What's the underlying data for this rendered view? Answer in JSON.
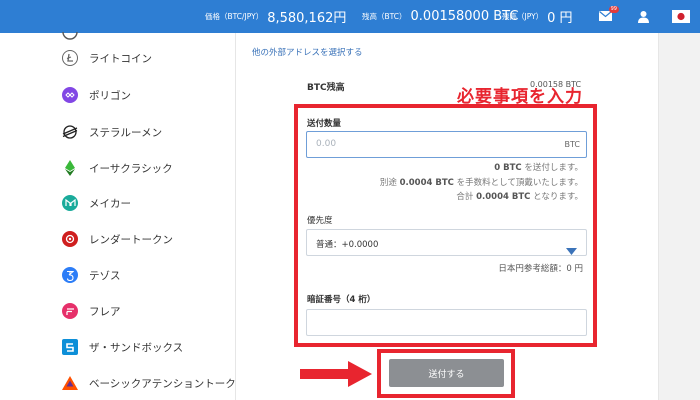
{
  "topbar": {
    "price_label": "価格（BTC/JPY）",
    "price_value": "8,580,162円",
    "btc_balance_label": "残高（BTC）",
    "btc_balance_value": "0.00158000 BTC",
    "jpy_balance_label": "残高（JPY）",
    "jpy_balance_value": "0 円",
    "mail_badge": "99",
    "color": "#2e7ed3"
  },
  "sidebar": {
    "items": [
      {
        "label": "ライトコイン",
        "icon": "litecoin-icon"
      },
      {
        "label": "ポリゴン",
        "icon": "polygon-icon"
      },
      {
        "label": "ステラルーメン",
        "icon": "stellar-icon"
      },
      {
        "label": "イーサクラシック",
        "icon": "ethereum-classic-icon"
      },
      {
        "label": "メイカー",
        "icon": "maker-icon"
      },
      {
        "label": "レンダートークン",
        "icon": "render-token-icon"
      },
      {
        "label": "テゾス",
        "icon": "tezos-icon"
      },
      {
        "label": "フレア",
        "icon": "flare-icon"
      },
      {
        "label": "ザ・サンドボックス",
        "icon": "sandbox-icon"
      },
      {
        "label": "ベーシックアテンショントークン",
        "icon": "bat-icon"
      }
    ]
  },
  "form": {
    "other_address_link": "他の外部アドレスを選択する",
    "btc_balance_label": "BTC残高",
    "btc_balance_value": "0.00158 BTC",
    "annotation": "必要事項を入力",
    "amount_label": "送付数量",
    "amount_placeholder": "0.00",
    "amount_unit": "BTC",
    "send_note_amount": "0 BTC",
    "send_note_suffix": "を送付します。",
    "fee_note_prefix": "別途",
    "fee_note_amount": "0.0004 BTC",
    "fee_note_suffix": "を手数料として頂戴いたします。",
    "total_note_prefix": "合計",
    "total_note_amount": "0.0004 BTC",
    "total_note_suffix": "となります。",
    "priority_label": "優先度",
    "priority_value": "普通：+0.0000",
    "jpy_reference": "日本円参考総額：0 円",
    "pin_label": "暗証番号（4 桁）",
    "pin_value": "",
    "send_button": "送付する"
  },
  "colors": {
    "annotation_red": "#e8252f",
    "link_blue": "#3b73b9",
    "button_gray": "#8c8f93"
  }
}
